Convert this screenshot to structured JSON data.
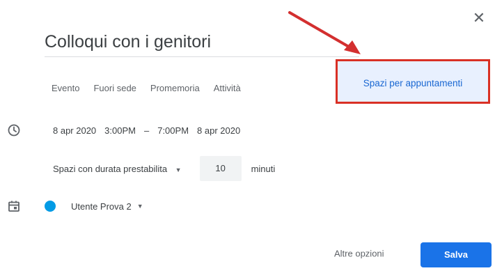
{
  "dialog": {
    "title": "Colloqui con i genitori",
    "close_icon": "close-icon"
  },
  "tabs": [
    {
      "label": "Evento"
    },
    {
      "label": "Fuori sede"
    },
    {
      "label": "Promemoria"
    },
    {
      "label": "Attività"
    },
    {
      "label": "Spazi per appuntamenti",
      "active": true
    }
  ],
  "schedule": {
    "start_date": "8 apr 2020",
    "start_time": "3:00PM",
    "separator": "–",
    "end_time": "7:00PM",
    "end_date": "8 apr 2020"
  },
  "slots": {
    "mode": "Spazi con durata prestabilita",
    "duration": "10",
    "unit": "minuti"
  },
  "calendar": {
    "name": "Utente Prova 2",
    "color": "#039be5"
  },
  "footer": {
    "more_options": "Altre opzioni",
    "save": "Salva"
  },
  "colors": {
    "accent": "#1a73e8",
    "highlight_border": "#d93025",
    "arrow": "#d32f2f"
  }
}
